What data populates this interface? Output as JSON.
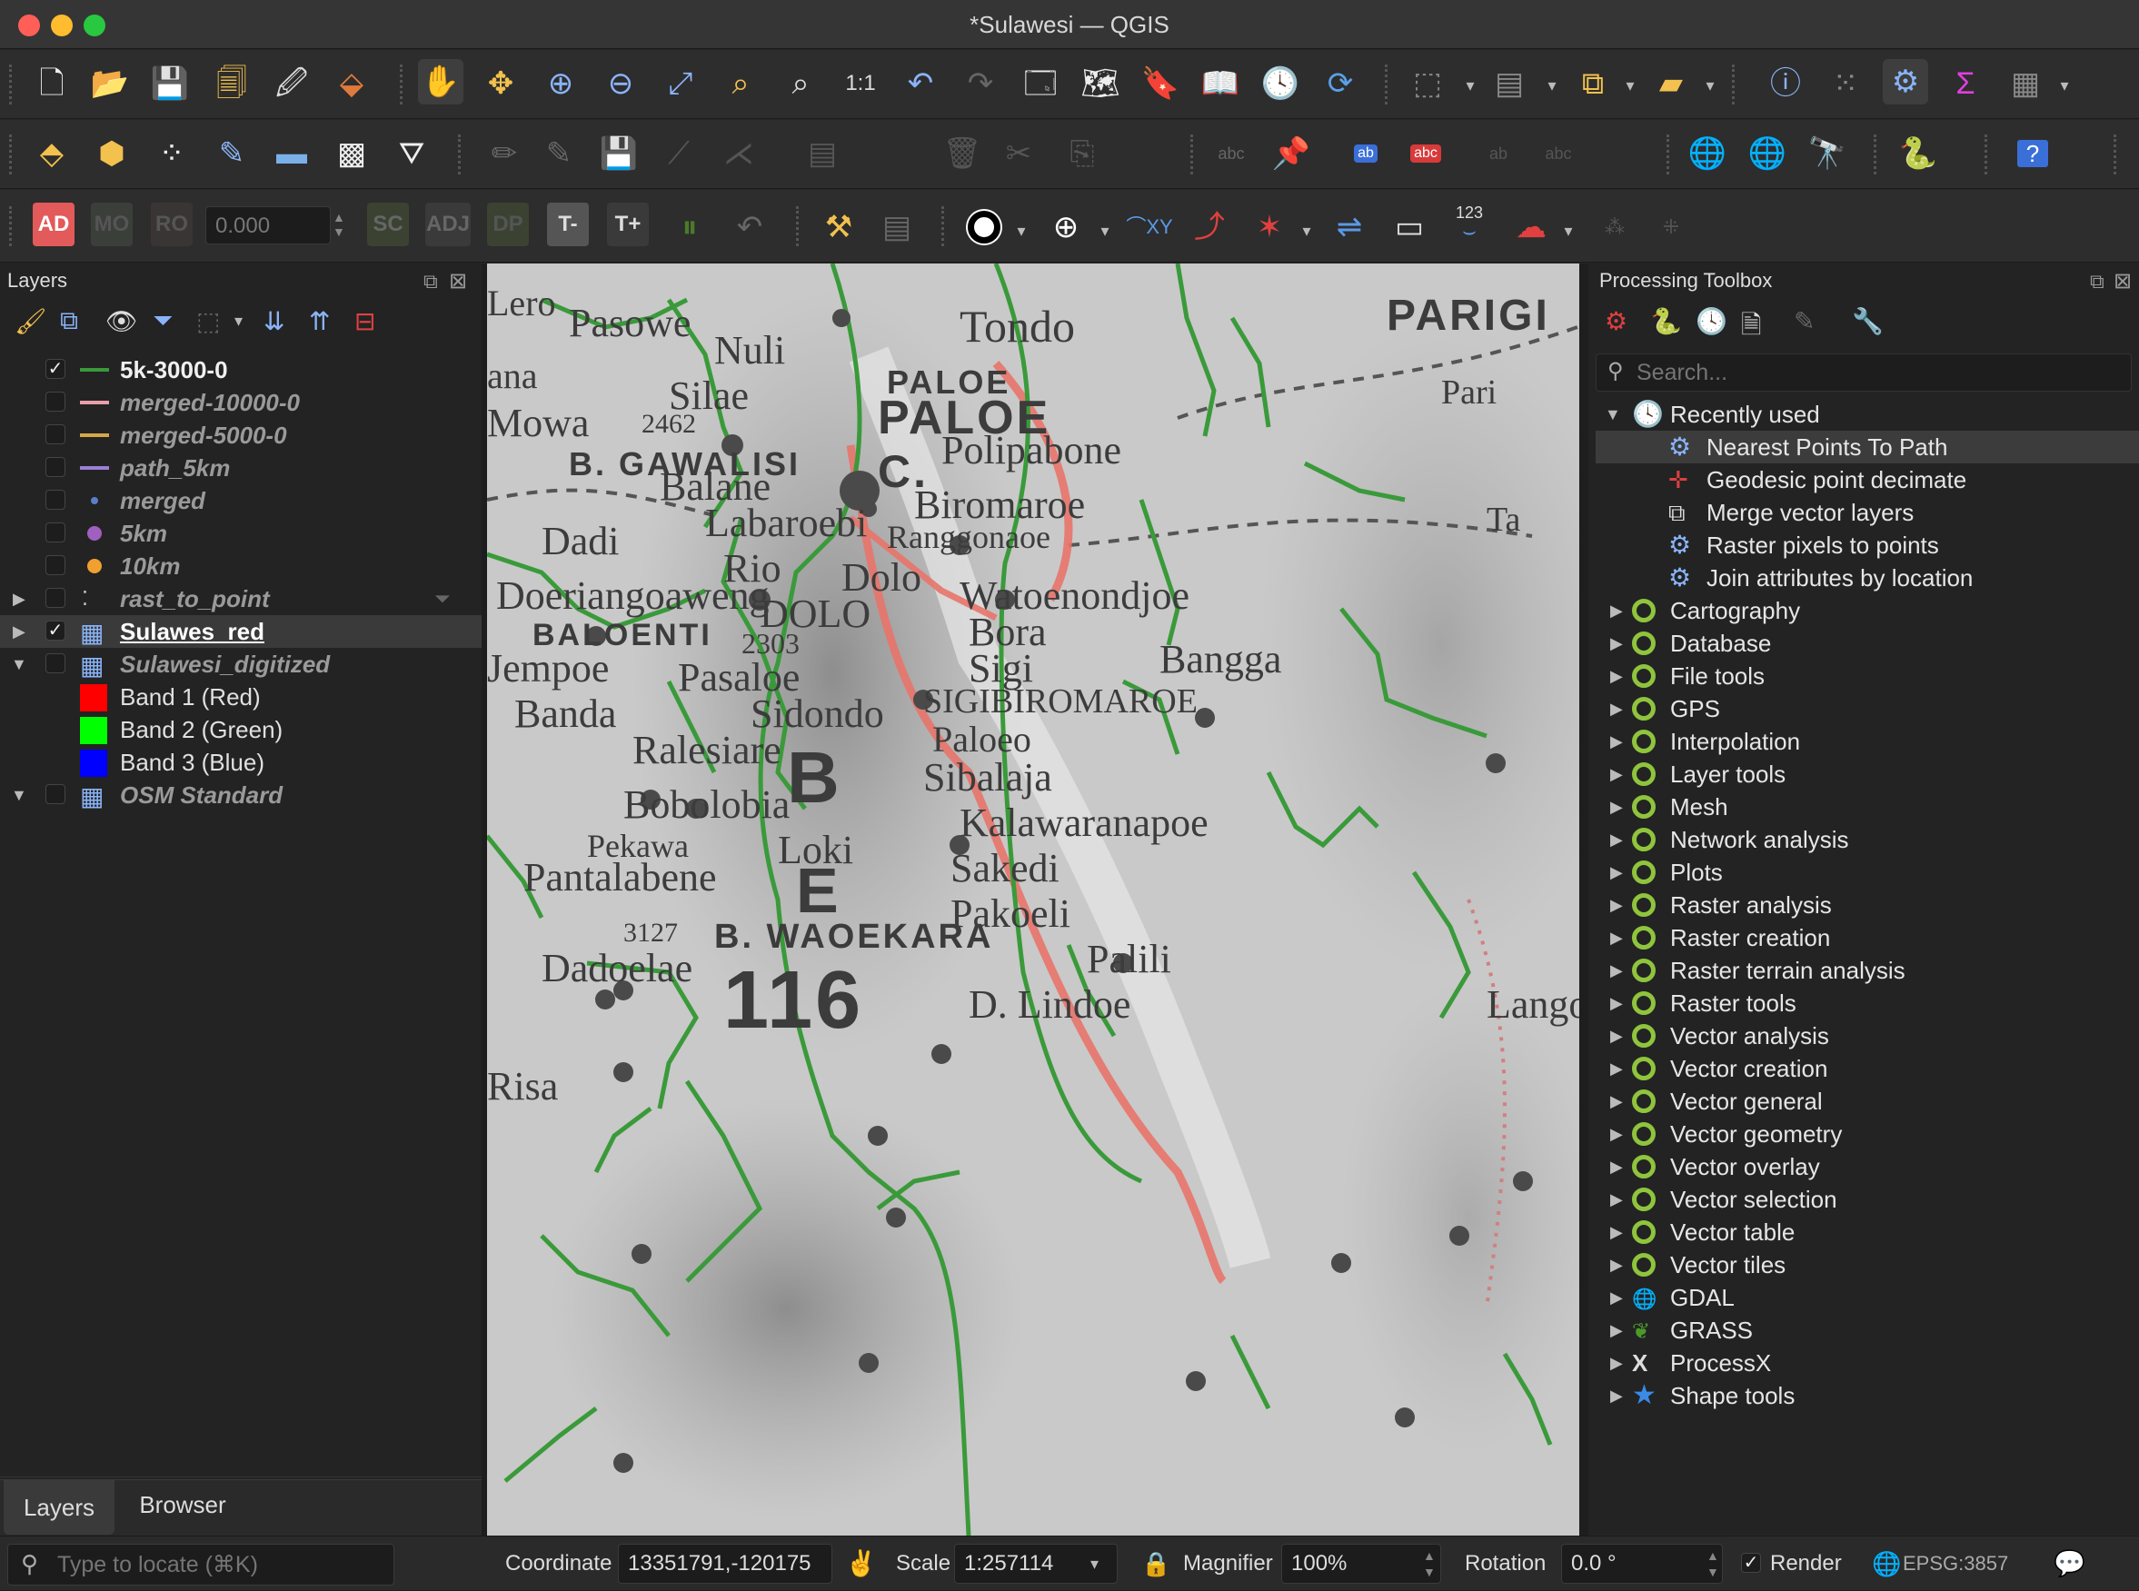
{
  "window": {
    "title": "*Sulawesi — QGIS"
  },
  "toolbar3": {
    "ad": "AD",
    "mo": "MO",
    "ro": "RO",
    "value": "0.000",
    "sc": "SC",
    "adj": "ADJ",
    "dp": "DP",
    "tminus": "T-",
    "tplus": "T+",
    "counter": "123"
  },
  "layers_panel": {
    "title": "Layers",
    "items": [
      {
        "label": "5k-3000-0",
        "checked": "✓",
        "color": "#3a9a3a",
        "style": "bold"
      },
      {
        "label": "merged-10000-0",
        "color": "#e8a0a8",
        "style": "italic"
      },
      {
        "label": "merged-5000-0",
        "color": "#d4a84a",
        "style": "italic"
      },
      {
        "label": "path_5km",
        "color": "#9b7fd6",
        "style": "italic"
      },
      {
        "label": "merged",
        "color": "#5a7fc8",
        "style": "italic"
      },
      {
        "label": "5km",
        "color": "#a060c0",
        "style": "italic"
      },
      {
        "label": "10km",
        "color": "#f0a030",
        "style": "italic"
      },
      {
        "label": "rast_to_point",
        "color": "#cccccc",
        "style": "italic"
      },
      {
        "label": "Sulawes_red",
        "checked": "✓",
        "color": "#8ab4f8",
        "style": "bold-underline"
      },
      {
        "label": "Sulawesi_digitized",
        "color": "#8ab4f8",
        "style": "italic"
      },
      {
        "label": "Band 1 (Red)",
        "color": "#ff0000",
        "style": "plain"
      },
      {
        "label": "Band 2 (Green)",
        "color": "#00ff00",
        "style": "plain"
      },
      {
        "label": "Band 3 (Blue)",
        "color": "#0000ff",
        "style": "plain"
      },
      {
        "label": "OSM Standard",
        "color": "#8ab4f8",
        "style": "italic"
      }
    ],
    "tabs": [
      "Layers",
      "Browser"
    ],
    "locate_placeholder": "Type to locate (⌘K)"
  },
  "toolbox": {
    "title": "Processing Toolbox",
    "search_placeholder": "Search...",
    "recent_label": "Recently used",
    "recent": [
      "Nearest Points To Path",
      "Geodesic point decimate",
      "Merge vector layers",
      "Raster pixels to points",
      "Join attributes by location"
    ],
    "groups": [
      "Cartography",
      "Database",
      "File tools",
      "GPS",
      "Interpolation",
      "Layer tools",
      "Mesh",
      "Network analysis",
      "Plots",
      "Raster analysis",
      "Raster creation",
      "Raster terrain analysis",
      "Raster tools",
      "Vector analysis",
      "Vector creation",
      "Vector general",
      "Vector geometry",
      "Vector overlay",
      "Vector selection",
      "Vector table",
      "Vector tiles",
      "GDAL",
      "GRASS",
      "ProcessX",
      "Shape tools"
    ]
  },
  "map": {
    "labels": [
      "Tondo",
      "PARIGI",
      "Pasowe",
      "Lero",
      "ana",
      "Nuli",
      "Silae",
      "PALOE",
      "PALOE",
      "Mowa",
      "2462",
      "B. GAWALISI",
      "C.",
      "Polipabone",
      "Balane",
      "Biromaroe",
      "Dadi",
      "Labaroebi",
      "Ranggonaoe",
      "Rio",
      "Dolo",
      "Watoenondjoe",
      "Doeriangoaweng",
      "DOLO",
      "BALOENTI",
      "2303",
      "Bora",
      "Jempoe",
      "Sigi",
      "Bangga",
      "Pasaloe",
      "Banda",
      "Sidondo",
      "SIGIBIROMAROE",
      "Paloeo",
      "Ralesiare",
      "B",
      "Sibalaja",
      "Bobolobia",
      "Kalawaranapoe",
      "Pekawa",
      "Loki",
      "Sakedi",
      "Pantalabene",
      "E",
      "Pakoeli",
      "3127",
      "B. WAOEKARA",
      "Dadoelae",
      "Palili",
      "116",
      "D. Lindoe",
      "Risa",
      "Lango",
      "Pari",
      "Ta"
    ]
  },
  "statusbar": {
    "coordinate_label": "Coordinate",
    "coordinate": "13351791,-120175",
    "scale_label": "Scale",
    "scale": "1:257114",
    "magnifier_label": "Magnifier",
    "magnifier": "100%",
    "rotation_label": "Rotation",
    "rotation": "0.0 °",
    "render_label": "Render",
    "render_checked": "✓",
    "crs": "EPSG:3857"
  }
}
